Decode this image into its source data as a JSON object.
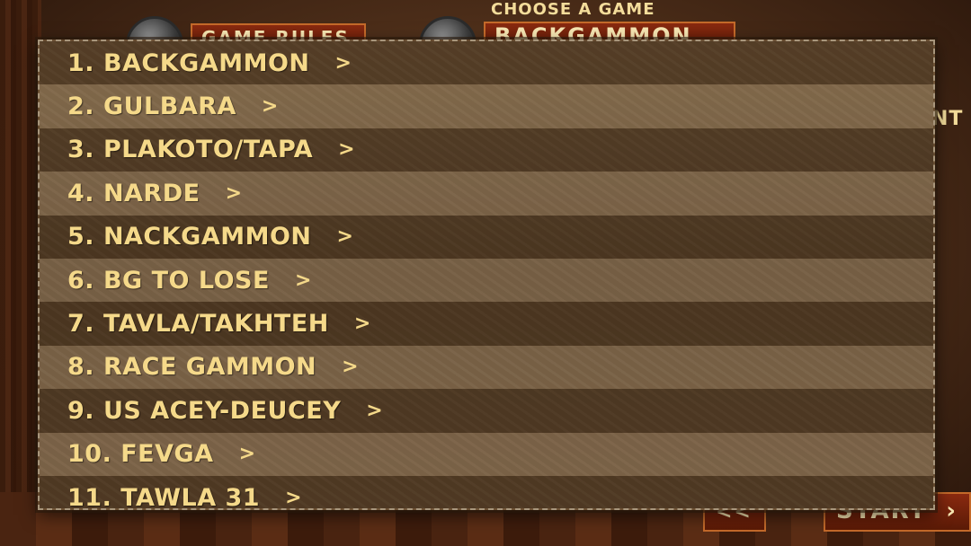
{
  "background": {
    "header_label": "CHOOSE A GAME",
    "game_rules_button": "GAME RULES",
    "selected_game": "BACKGAMMON",
    "right_partial_text": "NT",
    "back_button": "<<",
    "start_button": "START",
    "start_chevron": "›"
  },
  "game_list": {
    "items": [
      {
        "label": "1. BACKGAMMON",
        "arrow": ">"
      },
      {
        "label": "2. GULBARA",
        "arrow": ">"
      },
      {
        "label": "3. PLAKOTO/TAPA",
        "arrow": ">"
      },
      {
        "label": "4. NARDE",
        "arrow": ">"
      },
      {
        "label": "5. NACKGAMMON",
        "arrow": ">"
      },
      {
        "label": "6. BG TO LOSE",
        "arrow": ">"
      },
      {
        "label": "7. TAVLA/TAKHTEH",
        "arrow": ">"
      },
      {
        "label": "8. RACE GAMMON",
        "arrow": ">"
      },
      {
        "label": "9. US ACEY-DEUCEY",
        "arrow": ">"
      },
      {
        "label": "10. FEVGA",
        "arrow": ">"
      },
      {
        "label": "11. TAWLA 31",
        "arrow": ">"
      }
    ]
  },
  "colors": {
    "text": "#f5d98a",
    "button_red": "#8a2a10"
  }
}
